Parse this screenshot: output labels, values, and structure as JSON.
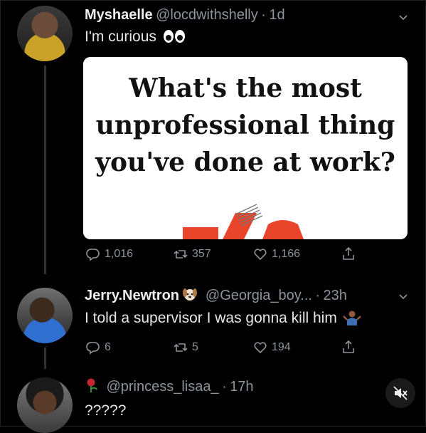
{
  "tweet1": {
    "name": "Myshaelle",
    "handle": "@locdwithshelly",
    "sep": "·",
    "time": "1d",
    "text": "I'm curious",
    "card_title_lines": [
      "What's the most",
      "unprofessional thing",
      "you've done at work?"
    ],
    "replies": "1,016",
    "retweets": "357",
    "likes": "1,166"
  },
  "tweet2": {
    "name": "Jerry.Newtron",
    "handle": "@Georgia_boy...",
    "sep": "·",
    "time": "23h",
    "text": "I told a supervisor I was gonna kill him",
    "replies": "6",
    "retweets": "5",
    "likes": "194"
  },
  "tweet3": {
    "handle": "@princess_lisaa_",
    "sep": "·",
    "time": "17h",
    "text": "?????"
  },
  "colors": {
    "background": "#000000",
    "muted_text": "#8b949a",
    "card_bg": "#ffffff"
  },
  "icons": [
    "reply-icon",
    "retweet-icon",
    "like-icon",
    "share-icon",
    "chevron-down-icon",
    "eyes-emoji-icon",
    "mute-icon"
  ]
}
